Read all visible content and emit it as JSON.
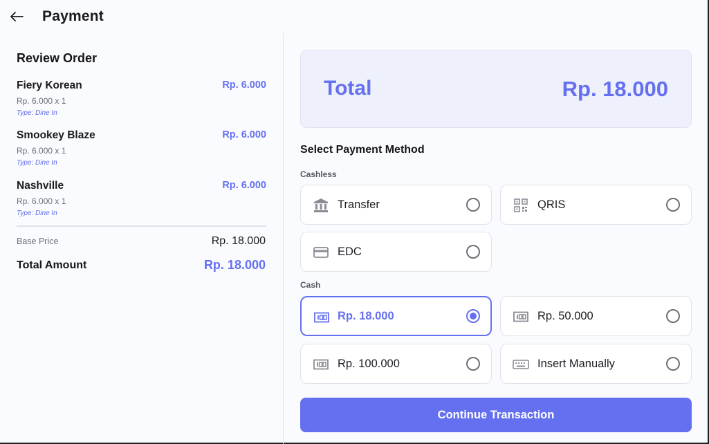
{
  "header": {
    "title": "Payment",
    "back_icon": "arrow-left-icon"
  },
  "review": {
    "title": "Review Order",
    "items": [
      {
        "name": "Fiery Korean",
        "price": "Rp. 6.000",
        "qty": "Rp. 6.000 x 1",
        "type": "Type: Dine In"
      },
      {
        "name": "Smookey Blaze",
        "price": "Rp. 6.000",
        "qty": "Rp. 6.000 x 1",
        "type": "Type: Dine In"
      },
      {
        "name": "Nashville",
        "price": "Rp. 6.000",
        "qty": "Rp. 6.000 x 1",
        "type": "Type: Dine In"
      }
    ],
    "base_price_label": "Base Price",
    "base_price_value": "Rp. 18.000",
    "total_amount_label": "Total Amount",
    "total_amount_value": "Rp. 18.000"
  },
  "payment": {
    "total_label": "Total",
    "total_value": "Rp. 18.000",
    "section_title": "Select Payment Method",
    "cashless_label": "Cashless",
    "cash_label": "Cash",
    "cashless_options": [
      {
        "label": "Transfer",
        "icon": "bank-icon",
        "selected": false
      },
      {
        "label": "QRIS",
        "icon": "qr-code-icon",
        "selected": false
      },
      {
        "label": "EDC",
        "icon": "credit-card-icon",
        "selected": false
      }
    ],
    "cash_options": [
      {
        "label": "Rp. 18.000",
        "icon": "cash-note-icon",
        "selected": true
      },
      {
        "label": "Rp. 50.000",
        "icon": "cash-note-icon",
        "selected": false
      },
      {
        "label": "Rp. 100.000",
        "icon": "cash-note-icon",
        "selected": false
      },
      {
        "label": "Insert Manually",
        "icon": "keyboard-icon",
        "selected": false
      }
    ],
    "continue_label": "Continue Transaction"
  },
  "colors": {
    "accent": "#6570f0",
    "card_bg": "#eef0fb",
    "page_bg": "#fafbfe"
  }
}
